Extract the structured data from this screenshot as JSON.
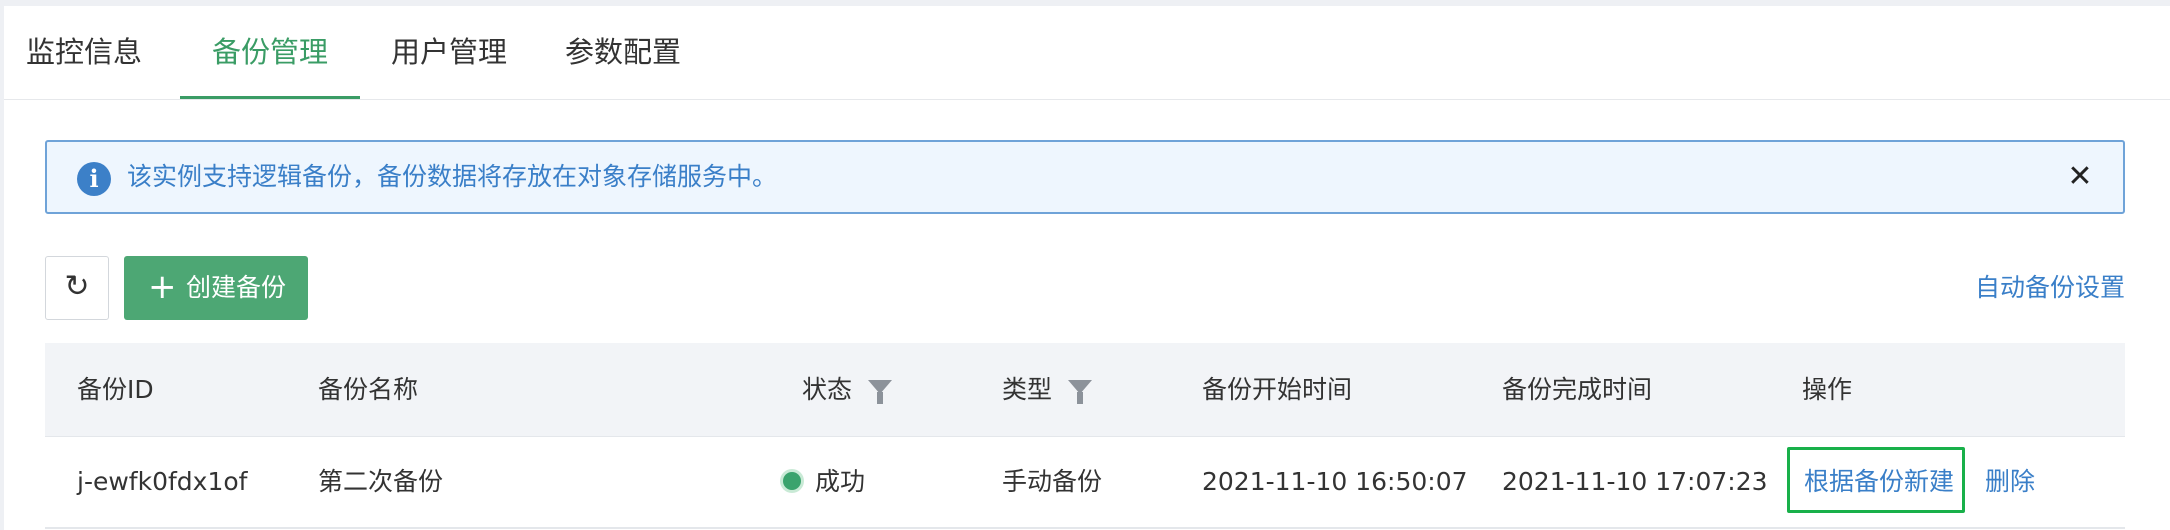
{
  "tabs": [
    "监控信息",
    "备份管理",
    "用户管理",
    "参数配置"
  ],
  "active_tab": "备份管理",
  "alert": {
    "text": "该实例支持逻辑备份，备份数据将存放在对象存储服务中。",
    "icon": "info-icon",
    "close_icon": "close-icon"
  },
  "toolbar": {
    "refresh_icon": "refresh-icon",
    "create_label": "创建备份",
    "auto_backup_link": "自动备份设置"
  },
  "table": {
    "columns": [
      "备份ID",
      "备份名称",
      "状态",
      "类型",
      "备份开始时间",
      "备份完成时间",
      "操作"
    ],
    "rows": [
      {
        "id": "j-ewfk0fdx1of",
        "name": "第二次备份",
        "status": "成功",
        "type": "手动备份",
        "start": "2021-11-10 16:50:07",
        "end": "2021-11-10 17:07:23",
        "actions": [
          "根据备份新建",
          "删除"
        ]
      }
    ]
  },
  "colors": {
    "accent": "#3a9c65",
    "create_button": "#4da774",
    "link": "#3a7fc8",
    "success": "#3aa36d",
    "highlight_border": "#18b04a"
  }
}
